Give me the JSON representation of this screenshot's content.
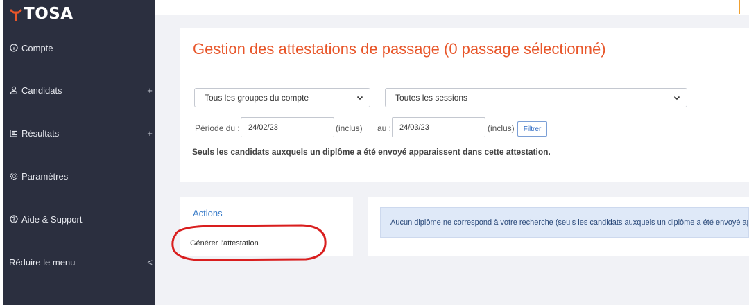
{
  "brand": {
    "name": "TOSA"
  },
  "colors": {
    "accent": "#e8562a",
    "sidebar_bg": "#2b2f3f",
    "link_blue": "#3b7dc9",
    "annotation_red": "#d91e1e"
  },
  "sidebar": {
    "items": [
      {
        "label": "Compte",
        "icon": "info-circle-icon",
        "trail": ""
      },
      {
        "label": "Candidats",
        "icon": "user-icon",
        "trail": "+"
      },
      {
        "label": "Résultats",
        "icon": "chart-list-icon",
        "trail": "+"
      },
      {
        "label": "Paramètres",
        "icon": "gear-icon",
        "trail": ""
      },
      {
        "label": "Aide & Support",
        "icon": "question-circle-icon",
        "trail": ""
      },
      {
        "label": "Réduire le menu",
        "icon": "",
        "trail": "<"
      }
    ]
  },
  "main": {
    "title": "Gestion des attestations de passage (0 passage sélectionné)",
    "group_select": "Tous les groupes du compte",
    "session_select": "Toutes les sessions",
    "period_from_label": "Période du :",
    "date_from": "24/02/23",
    "inclus_1": "(inclus)",
    "period_to_label": "au :",
    "date_to": "24/03/23",
    "inclus_2": "(inclus)",
    "filter_button": "Filtrer",
    "note": "Seuls les candidats auxquels un diplôme a été envoyé apparaissent dans cette attestation."
  },
  "actions": {
    "title": "Actions",
    "items": [
      "Générer l'attestation"
    ]
  },
  "results": {
    "message": "Aucun diplôme ne correspond à votre recherche (seuls les candidats auxquels un diplôme a été envoyé apparaissent dans cette attestation)."
  }
}
